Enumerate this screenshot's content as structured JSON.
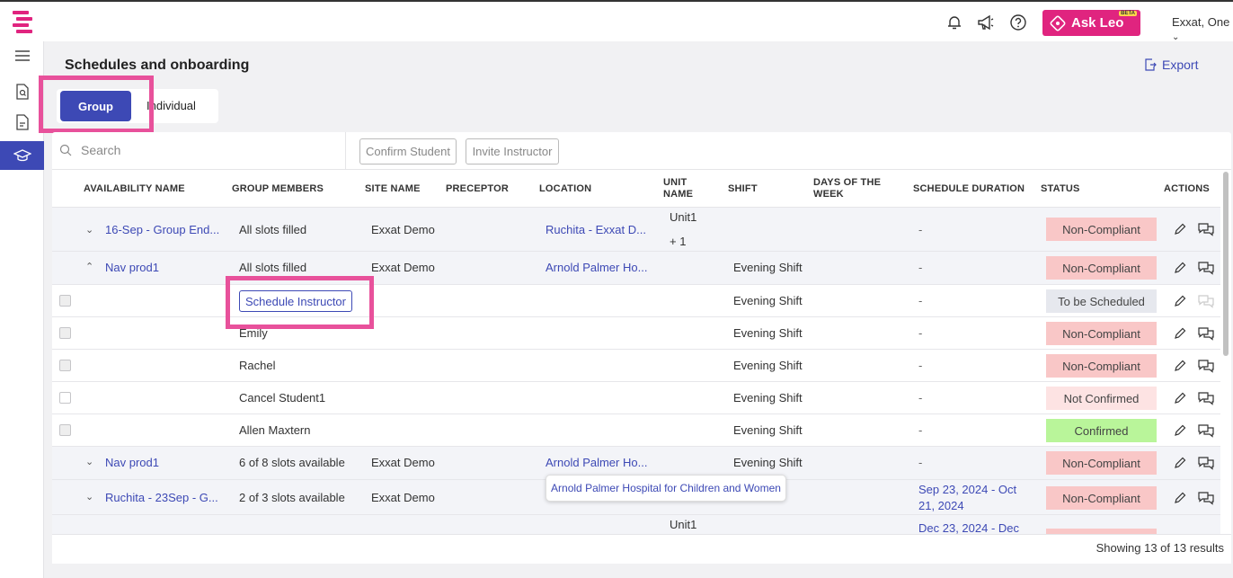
{
  "topbar": {
    "ask_leo_label": "Ask Leo",
    "beta_label": "BETA",
    "user_name": "Exxat, One"
  },
  "page": {
    "title": "Schedules and onboarding",
    "export_label": "Export",
    "toggle": {
      "group": "Group",
      "individual": "Individual"
    }
  },
  "toolbar": {
    "search_placeholder": "Search",
    "confirm_student": "Confirm Student",
    "invite_instructor": "Invite Instructor"
  },
  "columns": {
    "availability_name": "AVAILABILITY NAME",
    "group_members": "GROUP MEMBERS",
    "site_name": "SITE NAME",
    "preceptor": "PRECEPTOR",
    "location": "LOCATION",
    "unit_name_1": "UNIT",
    "unit_name_2": "NAME",
    "shift": "SHIFT",
    "days_1": "DAYS OF THE",
    "days_2": "WEEK",
    "schedule_duration": "SCHEDULE DURATION",
    "status": "STATUS",
    "actions": "ACTIONS"
  },
  "rows": [
    {
      "availability": "16-Sep - Group End...",
      "members": "All slots filled",
      "site": "Exxat Demo",
      "location": "Ruchita - Exxat D...",
      "unit": "Unit1",
      "unit_more": "+ 1",
      "shift": "",
      "duration": "-",
      "status": "Non-Compliant"
    },
    {
      "availability": "Nav prod1",
      "members": "All slots filled",
      "site": "Exxat Demo",
      "location": "Arnold Palmer Ho...",
      "shift": "Evening Shift",
      "duration": "-",
      "status": "Non-Compliant"
    },
    {
      "members": "Schedule Instructor",
      "shift": "Evening Shift",
      "duration": "-",
      "status": "To be Scheduled"
    },
    {
      "members": "Emily",
      "shift": "Evening Shift",
      "duration": "-",
      "status": "Non-Compliant"
    },
    {
      "members": "Rachel",
      "shift": "Evening Shift",
      "duration": "-",
      "status": "Non-Compliant"
    },
    {
      "members": "Cancel Student1",
      "shift": "Evening Shift",
      "duration": "-",
      "status": "Not Confirmed"
    },
    {
      "members": "Allen Maxtern",
      "shift": "Evening Shift",
      "duration": "-",
      "status": "Confirmed"
    },
    {
      "availability": "Nav prod1",
      "members": "6 of 8 slots available",
      "site": "Exxat Demo",
      "location": "Arnold Palmer Ho...",
      "shift": "Evening Shift",
      "duration": "-",
      "status": "Non-Compliant"
    },
    {
      "availability": "Ruchita - 23Sep - G...",
      "members": "2 of 3 slots available",
      "site": "Exxat Demo",
      "duration_1": "Sep 23, 2024 - Oct",
      "duration_2": "21, 2024",
      "status": "Non-Compliant"
    },
    {
      "unit": "Unit1",
      "duration_1": "Dec 23, 2024 - Dec"
    }
  ],
  "tooltip": "Arnold Palmer Hospital for Children and Women",
  "footer": {
    "results": "Showing 13 of 13 results"
  },
  "colors": {
    "accent": "#3d49b5",
    "brand_pink": "#e0247f",
    "highlight": "#e8519b",
    "non_compliant": "#f9c7c7",
    "confirmed": "#b9f59a"
  }
}
